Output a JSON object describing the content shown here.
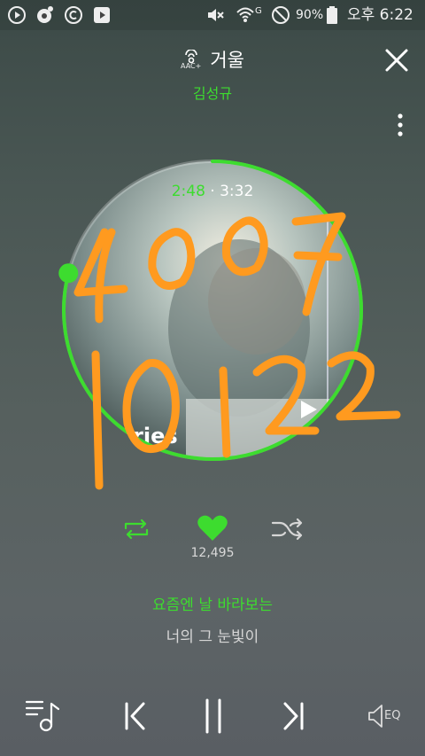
{
  "status_bar": {
    "battery": "90%",
    "time": "오후 6:22",
    "network": "G"
  },
  "track": {
    "title": "거울",
    "artist": "김성규",
    "format_badge": "AAC+",
    "album_text": "ries"
  },
  "playback": {
    "current_time": "2:48",
    "separator": "·",
    "total_time": "3:32",
    "progress": 0.79
  },
  "likes": {
    "count": "12,495"
  },
  "lyrics": {
    "current": "요즘엔 날 바라보는",
    "next": "너의 그 눈빛이"
  },
  "bottom_bar": {
    "eq_label": "EQ"
  },
  "handwriting": {
    "line1": "4 0 0 7",
    "line2": "10 1 2 2"
  },
  "colors": {
    "accent": "#3ddc2f",
    "annotation": "#ff9a1f"
  },
  "icons": {
    "status": [
      "play-circle-icon",
      "music-app-icon",
      "copyright-icon",
      "media-player-icon",
      "mute-icon",
      "wifi-icon",
      "dnd-icon",
      "battery-icon"
    ],
    "header": [
      "close-icon",
      "more-vert-icon"
    ],
    "controls": [
      "repeat-icon",
      "heart-icon",
      "shuffle-icon"
    ],
    "bottom": [
      "playlist-icon",
      "previous-icon",
      "pause-icon",
      "next-icon",
      "equalizer-icon"
    ]
  }
}
